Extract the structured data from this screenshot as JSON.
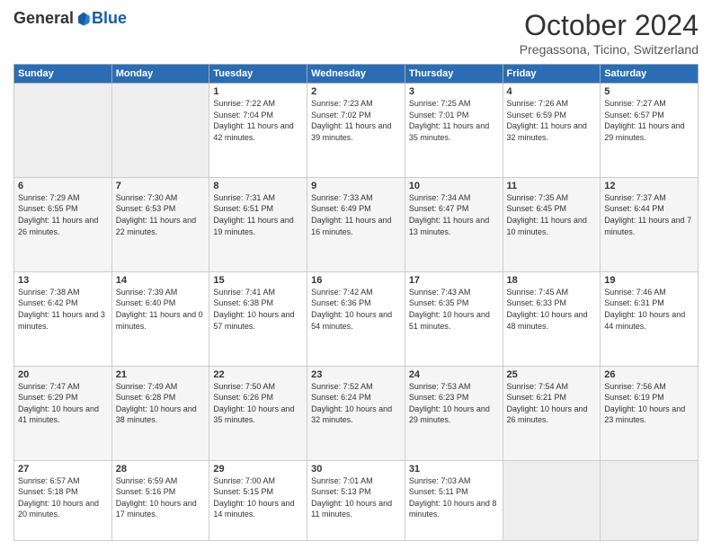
{
  "header": {
    "logo_general": "General",
    "logo_blue": "Blue",
    "month_title": "October 2024",
    "subtitle": "Pregassona, Ticino, Switzerland"
  },
  "weekdays": [
    "Sunday",
    "Monday",
    "Tuesday",
    "Wednesday",
    "Thursday",
    "Friday",
    "Saturday"
  ],
  "weeks": [
    [
      null,
      null,
      {
        "day": 1,
        "sunrise": "7:22 AM",
        "sunset": "7:04 PM",
        "daylight": "11 hours and 42 minutes."
      },
      {
        "day": 2,
        "sunrise": "7:23 AM",
        "sunset": "7:02 PM",
        "daylight": "11 hours and 39 minutes."
      },
      {
        "day": 3,
        "sunrise": "7:25 AM",
        "sunset": "7:01 PM",
        "daylight": "11 hours and 35 minutes."
      },
      {
        "day": 4,
        "sunrise": "7:26 AM",
        "sunset": "6:59 PM",
        "daylight": "11 hours and 32 minutes."
      },
      {
        "day": 5,
        "sunrise": "7:27 AM",
        "sunset": "6:57 PM",
        "daylight": "11 hours and 29 minutes."
      }
    ],
    [
      {
        "day": 6,
        "sunrise": "7:29 AM",
        "sunset": "6:55 PM",
        "daylight": "11 hours and 26 minutes."
      },
      {
        "day": 7,
        "sunrise": "7:30 AM",
        "sunset": "6:53 PM",
        "daylight": "11 hours and 22 minutes."
      },
      {
        "day": 8,
        "sunrise": "7:31 AM",
        "sunset": "6:51 PM",
        "daylight": "11 hours and 19 minutes."
      },
      {
        "day": 9,
        "sunrise": "7:33 AM",
        "sunset": "6:49 PM",
        "daylight": "11 hours and 16 minutes."
      },
      {
        "day": 10,
        "sunrise": "7:34 AM",
        "sunset": "6:47 PM",
        "daylight": "11 hours and 13 minutes."
      },
      {
        "day": 11,
        "sunrise": "7:35 AM",
        "sunset": "6:45 PM",
        "daylight": "11 hours and 10 minutes."
      },
      {
        "day": 12,
        "sunrise": "7:37 AM",
        "sunset": "6:44 PM",
        "daylight": "11 hours and 7 minutes."
      }
    ],
    [
      {
        "day": 13,
        "sunrise": "7:38 AM",
        "sunset": "6:42 PM",
        "daylight": "11 hours and 3 minutes."
      },
      {
        "day": 14,
        "sunrise": "7:39 AM",
        "sunset": "6:40 PM",
        "daylight": "11 hours and 0 minutes."
      },
      {
        "day": 15,
        "sunrise": "7:41 AM",
        "sunset": "6:38 PM",
        "daylight": "10 hours and 57 minutes."
      },
      {
        "day": 16,
        "sunrise": "7:42 AM",
        "sunset": "6:36 PM",
        "daylight": "10 hours and 54 minutes."
      },
      {
        "day": 17,
        "sunrise": "7:43 AM",
        "sunset": "6:35 PM",
        "daylight": "10 hours and 51 minutes."
      },
      {
        "day": 18,
        "sunrise": "7:45 AM",
        "sunset": "6:33 PM",
        "daylight": "10 hours and 48 minutes."
      },
      {
        "day": 19,
        "sunrise": "7:46 AM",
        "sunset": "6:31 PM",
        "daylight": "10 hours and 44 minutes."
      }
    ],
    [
      {
        "day": 20,
        "sunrise": "7:47 AM",
        "sunset": "6:29 PM",
        "daylight": "10 hours and 41 minutes."
      },
      {
        "day": 21,
        "sunrise": "7:49 AM",
        "sunset": "6:28 PM",
        "daylight": "10 hours and 38 minutes."
      },
      {
        "day": 22,
        "sunrise": "7:50 AM",
        "sunset": "6:26 PM",
        "daylight": "10 hours and 35 minutes."
      },
      {
        "day": 23,
        "sunrise": "7:52 AM",
        "sunset": "6:24 PM",
        "daylight": "10 hours and 32 minutes."
      },
      {
        "day": 24,
        "sunrise": "7:53 AM",
        "sunset": "6:23 PM",
        "daylight": "10 hours and 29 minutes."
      },
      {
        "day": 25,
        "sunrise": "7:54 AM",
        "sunset": "6:21 PM",
        "daylight": "10 hours and 26 minutes."
      },
      {
        "day": 26,
        "sunrise": "7:56 AM",
        "sunset": "6:19 PM",
        "daylight": "10 hours and 23 minutes."
      }
    ],
    [
      {
        "day": 27,
        "sunrise": "6:57 AM",
        "sunset": "5:18 PM",
        "daylight": "10 hours and 20 minutes."
      },
      {
        "day": 28,
        "sunrise": "6:59 AM",
        "sunset": "5:16 PM",
        "daylight": "10 hours and 17 minutes."
      },
      {
        "day": 29,
        "sunrise": "7:00 AM",
        "sunset": "5:15 PM",
        "daylight": "10 hours and 14 minutes."
      },
      {
        "day": 30,
        "sunrise": "7:01 AM",
        "sunset": "5:13 PM",
        "daylight": "10 hours and 11 minutes."
      },
      {
        "day": 31,
        "sunrise": "7:03 AM",
        "sunset": "5:11 PM",
        "daylight": "10 hours and 8 minutes."
      },
      null,
      null
    ]
  ]
}
